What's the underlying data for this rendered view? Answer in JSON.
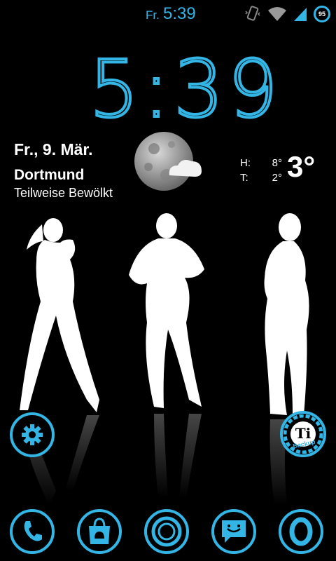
{
  "status_bar": {
    "day": "Fr.",
    "time": "5:39",
    "battery_level": "95",
    "icons": [
      "vibrate-icon",
      "wifi-icon",
      "signal-icon",
      "battery-icon"
    ]
  },
  "clock": {
    "time": "5:39"
  },
  "weather": {
    "date": "Fr., 9. Mär.",
    "city": "Dortmund",
    "condition": "Teilweise Bewölkt",
    "high_label": "H:",
    "high_value": "8°",
    "low_label": "T:",
    "low_value": "2°",
    "current_temp": "3°",
    "icon": "moon-cloud-icon"
  },
  "shortcuts": {
    "settings_icon": "gear-icon",
    "titanium_text": "Ti",
    "titanium_sub": "Backup"
  },
  "dock": [
    "phone-icon",
    "play-store-icon",
    "app-drawer-icon",
    "messaging-icon",
    "opera-icon"
  ],
  "colors": {
    "accent": "#33b5e5",
    "background": "#000000"
  }
}
